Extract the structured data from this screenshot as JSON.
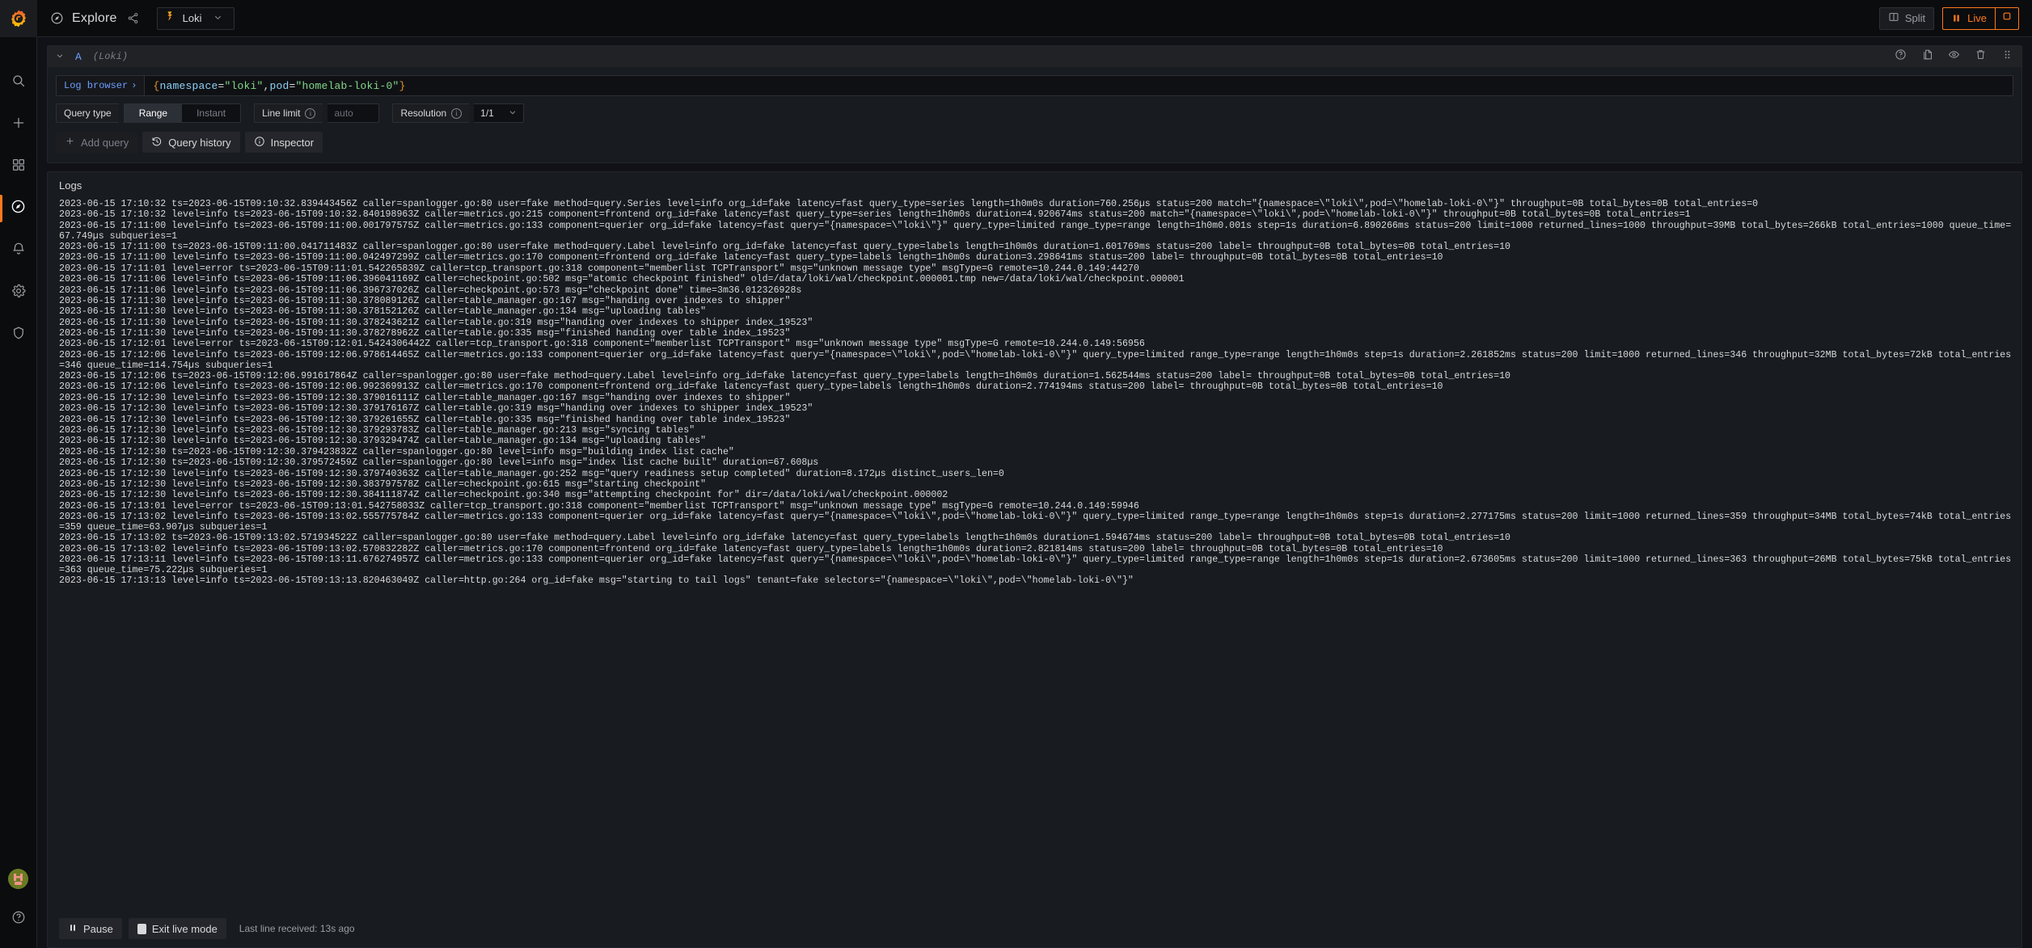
{
  "sidebar": {
    "brand_icon": "grafana-logo",
    "items": [
      {
        "icon": "search-icon",
        "name": "search"
      },
      {
        "icon": "plus-icon",
        "name": "create"
      },
      {
        "icon": "apps-grid-icon",
        "name": "dashboards"
      },
      {
        "icon": "compass-icon",
        "name": "explore",
        "active": true
      },
      {
        "icon": "bell-icon",
        "name": "alerting"
      },
      {
        "icon": "gear-icon",
        "name": "configuration"
      },
      {
        "icon": "shield-icon",
        "name": "server-admin"
      }
    ],
    "bottom": [
      {
        "icon": "avatar",
        "name": "user-profile",
        "initials": "H"
      },
      {
        "icon": "help-icon",
        "name": "help"
      }
    ]
  },
  "topbar": {
    "compass_icon": "compass-icon",
    "title": "Explore",
    "share_icon": "share-icon",
    "datasource": {
      "icon": "loki-icon",
      "name": "Loki",
      "chevron": "chevron-down-icon"
    },
    "split_label": "Split",
    "split_icon": "split-panes-icon",
    "live_label": "Live",
    "live_icon": "pause-icon",
    "stop_icon": "stop-square-icon",
    "accent_color": "#ff7a1c"
  },
  "query": {
    "row_letter": "A",
    "row_datasource": "(Loki)",
    "collapse_icon": "chevron-down-icon",
    "actions": [
      {
        "icon": "help-circle-icon",
        "name": "query-help"
      },
      {
        "icon": "copy-icon",
        "name": "duplicate-query"
      },
      {
        "icon": "eye-icon",
        "name": "toggle-query-visibility"
      },
      {
        "icon": "trash-icon",
        "name": "remove-query"
      },
      {
        "icon": "drag-handle-icon",
        "name": "drag-query"
      }
    ],
    "log_browser_label": "Log browser",
    "log_browser_chevron": "›",
    "expression": {
      "open_brace": "{",
      "label1": "namespace",
      "eq": "=",
      "value1": "\"loki\"",
      "comma": ",",
      "label2": "pod",
      "value2": "\"homelab-loki-0\"",
      "close_brace": "}"
    },
    "options": {
      "query_type_label": "Query type",
      "query_type_range": "Range",
      "query_type_instant": "Instant",
      "query_type_selected": "Range",
      "line_limit_label": "Line limit",
      "line_limit_placeholder": "auto",
      "line_limit_value": "",
      "resolution_label": "Resolution",
      "resolution_value": "1/1",
      "info_icon": "info-circle-icon"
    },
    "buttons": {
      "add_query": "Add query",
      "add_query_icon": "plus-icon",
      "query_history": "Query history",
      "query_history_icon": "history-icon",
      "inspector": "Inspector",
      "inspector_icon": "info-circle-icon"
    }
  },
  "logs": {
    "title": "Logs",
    "lines": [
      "2023-06-15 17:10:32 ts=2023-06-15T09:10:32.839443456Z caller=spanlogger.go:80 user=fake method=query.Series level=info org_id=fake latency=fast query_type=series length=1h0m0s duration=760.256µs status=200 match=\"{namespace=\\\"loki\\\",pod=\\\"homelab-loki-0\\\"}\" throughput=0B total_bytes=0B total_entries=0",
      "2023-06-15 17:10:32 level=info ts=2023-06-15T09:10:32.840198963Z caller=metrics.go:215 component=frontend org_id=fake latency=fast query_type=series length=1h0m0s duration=4.920674ms status=200 match=\"{namespace=\\\"loki\\\",pod=\\\"homelab-loki-0\\\"}\" throughput=0B total_bytes=0B total_entries=1",
      "2023-06-15 17:11:00 level=info ts=2023-06-15T09:11:00.001797575Z caller=metrics.go:133 component=querier org_id=fake latency=fast query=\"{namespace=\\\"loki\\\"}\" query_type=limited range_type=range length=1h0m0.001s step=1s duration=6.890266ms status=200 limit=1000 returned_lines=1000 throughput=39MB total_bytes=266kB total_entries=1000 queue_time=67.749µs subqueries=1",
      "2023-06-15 17:11:00 ts=2023-06-15T09:11:00.041711483Z caller=spanlogger.go:80 user=fake method=query.Label level=info org_id=fake latency=fast query_type=labels length=1h0m0s duration=1.601769ms status=200 label= throughput=0B total_bytes=0B total_entries=10",
      "2023-06-15 17:11:00 level=info ts=2023-06-15T09:11:00.042497299Z caller=metrics.go:170 component=frontend org_id=fake latency=fast query_type=labels length=1h0m0s duration=3.298641ms status=200 label= throughput=0B total_bytes=0B total_entries=10",
      "2023-06-15 17:11:01 level=error ts=2023-06-15T09:11:01.542265839Z caller=tcp_transport.go:318 component=\"memberlist TCPTransport\" msg=\"unknown message type\" msgType=G remote=10.244.0.149:44270",
      "2023-06-15 17:11:06 level=info ts=2023-06-15T09:11:06.396041169Z caller=checkpoint.go:502 msg=\"atomic checkpoint finished\" old=/data/loki/wal/checkpoint.000001.tmp new=/data/loki/wal/checkpoint.000001",
      "2023-06-15 17:11:06 level=info ts=2023-06-15T09:11:06.396737026Z caller=checkpoint.go:573 msg=\"checkpoint done\" time=3m36.012326928s",
      "2023-06-15 17:11:30 level=info ts=2023-06-15T09:11:30.378089126Z caller=table_manager.go:167 msg=\"handing over indexes to shipper\"",
      "2023-06-15 17:11:30 level=info ts=2023-06-15T09:11:30.378152126Z caller=table_manager.go:134 msg=\"uploading tables\"",
      "2023-06-15 17:11:30 level=info ts=2023-06-15T09:11:30.378243621Z caller=table.go:319 msg=\"handing over indexes to shipper index_19523\"",
      "2023-06-15 17:11:30 level=info ts=2023-06-15T09:11:30.378278962Z caller=table.go:335 msg=\"finished handing over table index_19523\"",
      "2023-06-15 17:12:01 level=error ts=2023-06-15T09:12:01.5424306442Z caller=tcp_transport.go:318 component=\"memberlist TCPTransport\" msg=\"unknown message type\" msgType=G remote=10.244.0.149:56956",
      "2023-06-15 17:12:06 level=info ts=2023-06-15T09:12:06.978614465Z caller=metrics.go:133 component=querier org_id=fake latency=fast query=\"{namespace=\\\"loki\\\",pod=\\\"homelab-loki-0\\\"}\" query_type=limited range_type=range length=1h0m0s step=1s duration=2.261852ms status=200 limit=1000 returned_lines=346 throughput=32MB total_bytes=72kB total_entries=346 queue_time=114.754µs subqueries=1",
      "2023-06-15 17:12:06 ts=2023-06-15T09:12:06.991617864Z caller=spanlogger.go:80 user=fake method=query.Label level=info org_id=fake latency=fast query_type=labels length=1h0m0s duration=1.562544ms status=200 label= throughput=0B total_bytes=0B total_entries=10",
      "2023-06-15 17:12:06 level=info ts=2023-06-15T09:12:06.992369913Z caller=metrics.go:170 component=frontend org_id=fake latency=fast query_type=labels length=1h0m0s duration=2.774194ms status=200 label= throughput=0B total_bytes=0B total_entries=10",
      "2023-06-15 17:12:30 level=info ts=2023-06-15T09:12:30.379016111Z caller=table_manager.go:167 msg=\"handing over indexes to shipper\"",
      "2023-06-15 17:12:30 level=info ts=2023-06-15T09:12:30.379176167Z caller=table.go:319 msg=\"handing over indexes to shipper index_19523\"",
      "2023-06-15 17:12:30 level=info ts=2023-06-15T09:12:30.379261655Z caller=table.go:335 msg=\"finished handing over table index_19523\"",
      "2023-06-15 17:12:30 level=info ts=2023-06-15T09:12:30.379293783Z caller=table_manager.go:213 msg=\"syncing tables\"",
      "2023-06-15 17:12:30 level=info ts=2023-06-15T09:12:30.379329474Z caller=table_manager.go:134 msg=\"uploading tables\"",
      "2023-06-15 17:12:30 ts=2023-06-15T09:12:30.379423832Z caller=spanlogger.go:80 level=info msg=\"building index list cache\"",
      "2023-06-15 17:12:30 ts=2023-06-15T09:12:30.379572459Z caller=spanlogger.go:80 level=info msg=\"index list cache built\" duration=67.608µs",
      "2023-06-15 17:12:30 level=info ts=2023-06-15T09:12:30.379740363Z caller=table_manager.go:252 msg=\"query readiness setup completed\" duration=8.172µs distinct_users_len=0",
      "2023-06-15 17:12:30 level=info ts=2023-06-15T09:12:30.383797578Z caller=checkpoint.go:615 msg=\"starting checkpoint\"",
      "2023-06-15 17:12:30 level=info ts=2023-06-15T09:12:30.384111874Z caller=checkpoint.go:340 msg=\"attempting checkpoint for\" dir=/data/loki/wal/checkpoint.000002",
      "2023-06-15 17:13:01 level=error ts=2023-06-15T09:13:01.542758033Z caller=tcp_transport.go:318 component=\"memberlist TCPTransport\" msg=\"unknown message type\" msgType=G remote=10.244.0.149:59946",
      "2023-06-15 17:13:02 level=info ts=2023-06-15T09:13:02.555775784Z caller=metrics.go:133 component=querier org_id=fake latency=fast query=\"{namespace=\\\"loki\\\",pod=\\\"homelab-loki-0\\\"}\" query_type=limited range_type=range length=1h0m0s step=1s duration=2.277175ms status=200 limit=1000 returned_lines=359 throughput=34MB total_bytes=74kB total_entries=359 queue_time=63.907µs subqueries=1",
      "2023-06-15 17:13:02 ts=2023-06-15T09:13:02.571934522Z caller=spanlogger.go:80 user=fake method=query.Label level=info org_id=fake latency=fast query_type=labels length=1h0m0s duration=1.594674ms status=200 label= throughput=0B total_bytes=0B total_entries=10",
      "2023-06-15 17:13:02 level=info ts=2023-06-15T09:13:02.570832282Z caller=metrics.go:170 component=frontend org_id=fake latency=fast query_type=labels length=1h0m0s duration=2.821814ms status=200 label= throughput=0B total_bytes=0B total_entries=10",
      "2023-06-15 17:13:11 level=info ts=2023-06-15T09:13:11.676274957Z caller=metrics.go:133 component=querier org_id=fake latency=fast query=\"{namespace=\\\"loki\\\",pod=\\\"homelab-loki-0\\\"}\" query_type=limited range_type=range length=1h0m0s step=1s duration=2.673605ms status=200 limit=1000 returned_lines=363 throughput=26MB total_bytes=75kB total_entries=363 queue_time=75.222µs subqueries=1",
      "2023-06-15 17:13:13 level=info ts=2023-06-15T09:13:13.820463049Z caller=http.go:264 org_id=fake msg=\"starting to tail logs\" tenant=fake selectors=\"{namespace=\\\"loki\\\",pod=\\\"homelab-loki-0\\\"}\""
    ],
    "footer": {
      "pause_label": "Pause",
      "pause_icon": "pause-icon",
      "exit_live_label": "Exit live mode",
      "exit_live_icon": "stop-square-icon",
      "status": "Last line received: 13s ago"
    }
  }
}
